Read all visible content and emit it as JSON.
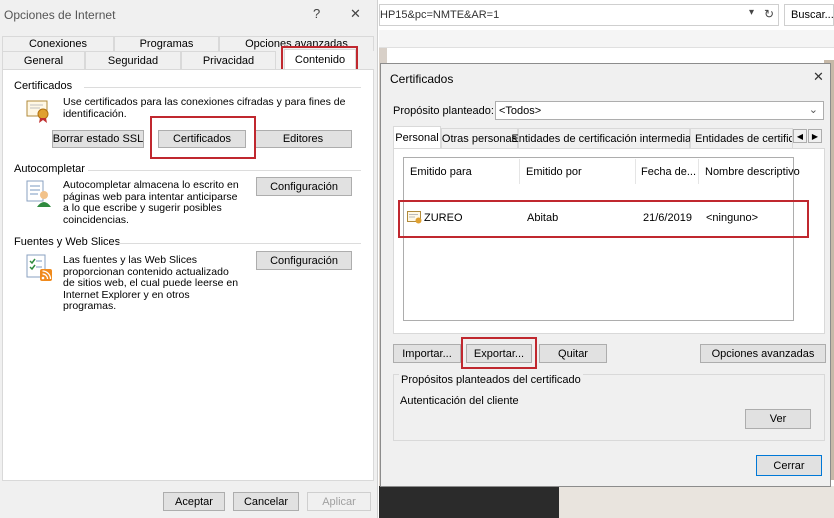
{
  "internet_options": {
    "title": "Opciones de Internet",
    "help_glyph": "?",
    "close_glyph": "✕",
    "tabs_row1": [
      "Conexiones",
      "Programas",
      "Opciones avanzadas"
    ],
    "tabs_row2": [
      "General",
      "Seguridad",
      "Privacidad",
      "Contenido"
    ],
    "active_tab": "Contenido",
    "certificates": {
      "heading": "Certificados",
      "description": "Use certificados para las conexiones cifradas y para fines de identificación.",
      "clear_ssl_label": "Borrar estado SSL",
      "certificates_label": "Certificados",
      "publishers_label": "Editores"
    },
    "autocomplete": {
      "heading": "Autocompletar",
      "description": "Autocompletar almacena lo escrito en páginas web para intentar anticiparse a lo que escribe y sugerir posibles coincidencias.",
      "settings_label": "Configuración"
    },
    "feeds": {
      "heading": "Fuentes y Web Slices",
      "description": "Las fuentes y las Web Slices proporcionan contenido actualizado de sitios web, el cual puede leerse en Internet Explorer y en otros programas.",
      "settings_label": "Configuración"
    },
    "footer": {
      "accept": "Aceptar",
      "cancel": "Cancelar",
      "apply": "Aplicar"
    }
  },
  "browser": {
    "address_text": "HP15&pc=NMTE&AR=1",
    "search_label": "Buscar..."
  },
  "certificates_dialog": {
    "title": "Certificados",
    "close_glyph": "✕",
    "purpose_label": "Propósito planteado:",
    "purpose_value": "<Todos>",
    "tabs": [
      "Personal",
      "Otras personas",
      "Entidades de certificación intermedias",
      "Entidades de certificación"
    ],
    "active_tab": "Personal",
    "columns": [
      "Emitido para",
      "Emitido por",
      "Fecha de...",
      "Nombre descriptivo"
    ],
    "rows": [
      {
        "issued_to": "ZUREO",
        "issued_by": "Abitab",
        "date": "21/6/2019",
        "friendly_name": "<ninguno>"
      }
    ],
    "buttons": {
      "import": "Importar...",
      "export": "Exportar...",
      "remove": "Quitar",
      "advanced": "Opciones avanzadas",
      "view": "Ver",
      "close": "Cerrar"
    },
    "purposes_group": {
      "heading": "Propósitos planteados del certificado",
      "value": "Autenticación del cliente"
    }
  },
  "colors": {
    "highlight": "#c0282f",
    "dialog_bg": "#f0f0f0",
    "button_bg": "#e1e1e1",
    "close_button_border": "#0078d7"
  }
}
